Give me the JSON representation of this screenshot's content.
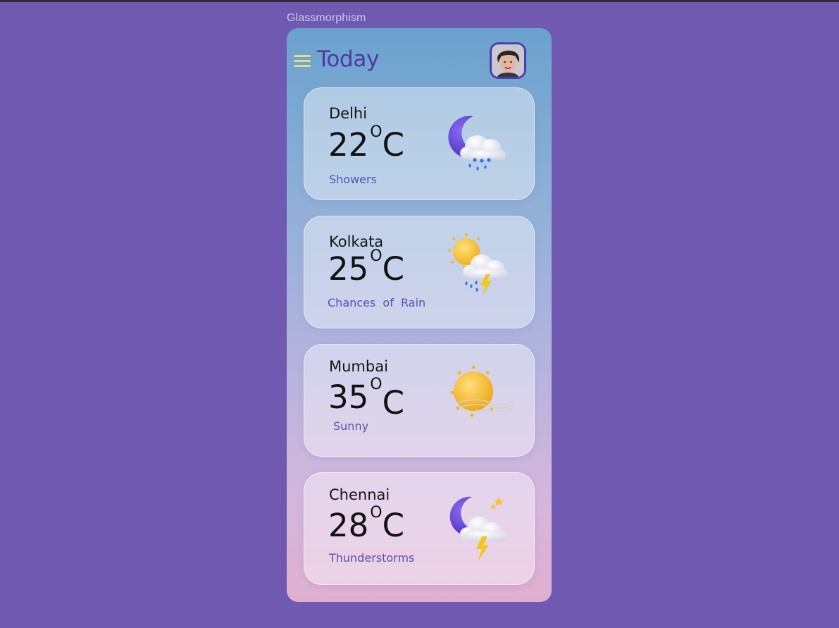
{
  "frame_label": "Glassmorphism",
  "header": {
    "title": "Today"
  },
  "colors": {
    "background": "#7059b0",
    "title": "#4a3aa8",
    "condition_text": "#5b4fb0",
    "menu_icon": "#e8d98a"
  },
  "cards": [
    {
      "city": "Delhi",
      "temp": "22",
      "deg": "O",
      "unit": "C",
      "condition": "Showers",
      "icon": "moon-cloud-rain-icon"
    },
    {
      "city": "Kolkata",
      "temp": "25",
      "deg": "O",
      "unit": "C",
      "condition": "Chances  of  Rain",
      "icon": "sun-cloud-thunder-rain-icon"
    },
    {
      "city": "Mumbai",
      "temp": "35",
      "deg": "O",
      "unit": "C",
      "condition": "Sunny",
      "icon": "sun-wind-icon"
    },
    {
      "city": "Chennai",
      "temp": "28",
      "deg": "O",
      "unit": "C",
      "condition": "Thunderstorms",
      "icon": "moon-cloud-thunder-icon"
    }
  ]
}
